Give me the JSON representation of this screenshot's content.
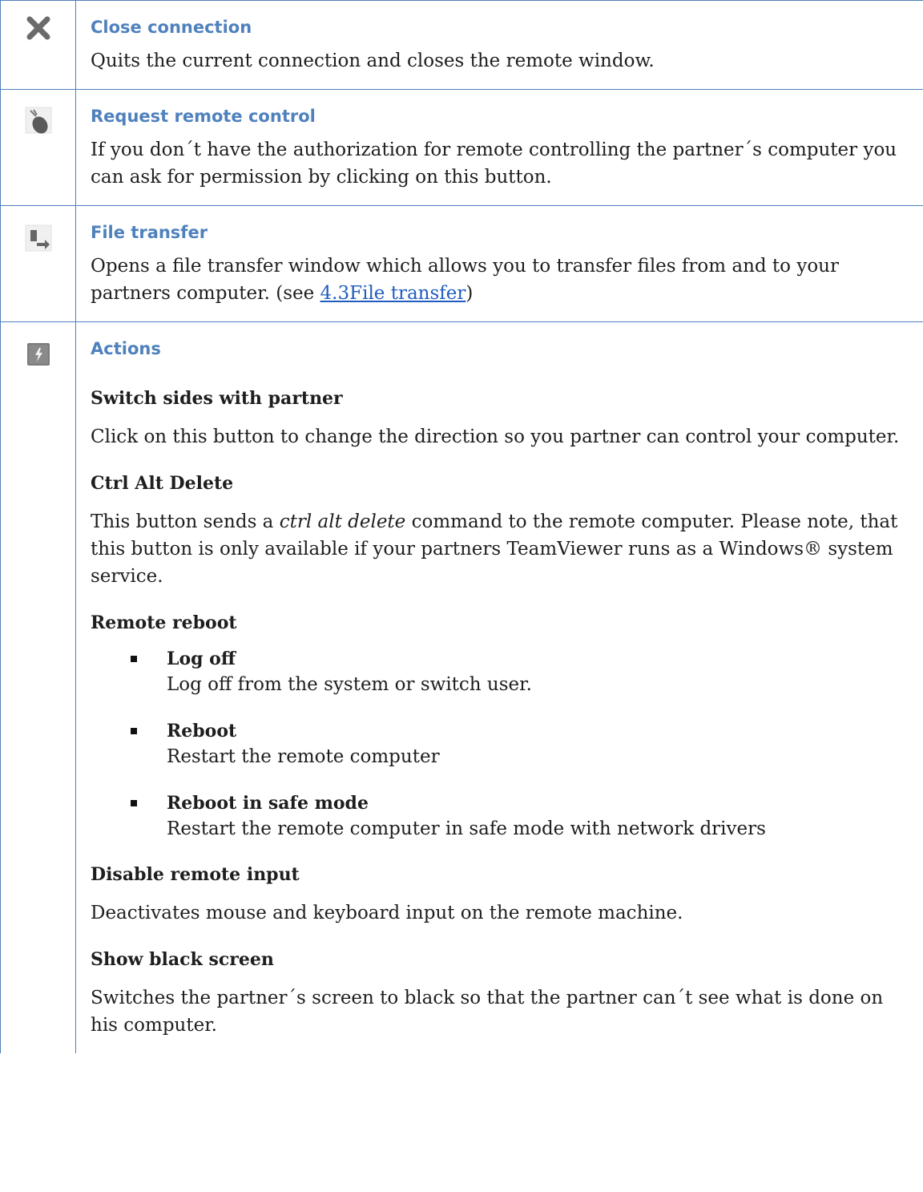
{
  "rows": [
    {
      "icon": "close-x-icon",
      "title": "Close connection",
      "text": "Quits the current connection and closes the remote window."
    },
    {
      "icon": "mouse-request-icon",
      "title": "Request remote control",
      "text": "If you don´t have the authorization for remote controlling the partner´s computer you can ask for permission by clicking on this button."
    },
    {
      "icon": "file-transfer-icon",
      "title": "File transfer",
      "text_before": "Opens a file transfer window which allows you to transfer files from and to your partners computer. (see ",
      "link": "4.3File transfer",
      "text_after": ")"
    },
    {
      "icon": "actions-icon",
      "title": "Actions",
      "switch_sides": {
        "title": "Switch sides with partner",
        "text": "Click on this button to change the direction so you partner can control your computer."
      },
      "ctrl_alt_delete": {
        "title": "Ctrl Alt Delete",
        "text_before": "This button sends a ",
        "italic": "ctrl alt delete",
        "text_after": " command to the remote computer. Please note, that this button is only available if your partners TeamViewer runs as a Windows® system service."
      },
      "remote_reboot": {
        "title": "Remote reboot",
        "options": [
          {
            "title": "Log off",
            "text": "Log off from the system or switch user."
          },
          {
            "title": "Reboot",
            "text": "Restart the remote computer"
          },
          {
            "title": "Reboot in safe mode",
            "text": "Restart the remote computer in safe mode with network drivers"
          }
        ]
      },
      "disable_input": {
        "title": "Disable remote input",
        "text": "Deactivates mouse and keyboard input on the remote machine."
      },
      "black_screen": {
        "title": "Show black screen",
        "text": "Switches the partner´s screen to black so that the partner can´t see what is done on his computer."
      }
    }
  ]
}
